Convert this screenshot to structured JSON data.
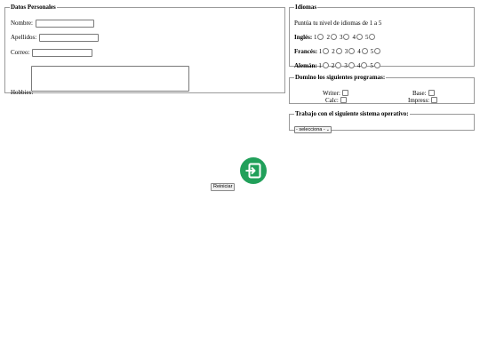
{
  "personal": {
    "legend": "Datos Personales",
    "nombre_label": "Nombre:",
    "nombre_value": "",
    "apellidos_label": "Apellidos:",
    "apellidos_value": "",
    "correo_label": "Correo:",
    "correo_value": "",
    "hobbies_label": "Hobbies:",
    "hobbies_value": ""
  },
  "idiomas": {
    "legend": "Idiomas",
    "intro": "Puntúa tu nivel de idiomas de 1 a 5",
    "rows": [
      {
        "label": "Inglés:"
      },
      {
        "label": "Francés:"
      },
      {
        "label": "Alemán:"
      }
    ],
    "levels": [
      "1",
      "2",
      "3",
      "4",
      "5"
    ]
  },
  "programas": {
    "legend": "Domino los siguientes programas:",
    "items": [
      {
        "label": "Writer:"
      },
      {
        "label": "Base:"
      },
      {
        "label": "Calc:"
      },
      {
        "label": "Impress:"
      }
    ]
  },
  "sistema": {
    "legend": "Trabajo con el siguiente sistema operativo:",
    "selected": "- selecciona -"
  },
  "actions": {
    "submit_icon": "login-enter-icon",
    "reset_label": "Reiniciar",
    "accent": "#21a05a"
  }
}
